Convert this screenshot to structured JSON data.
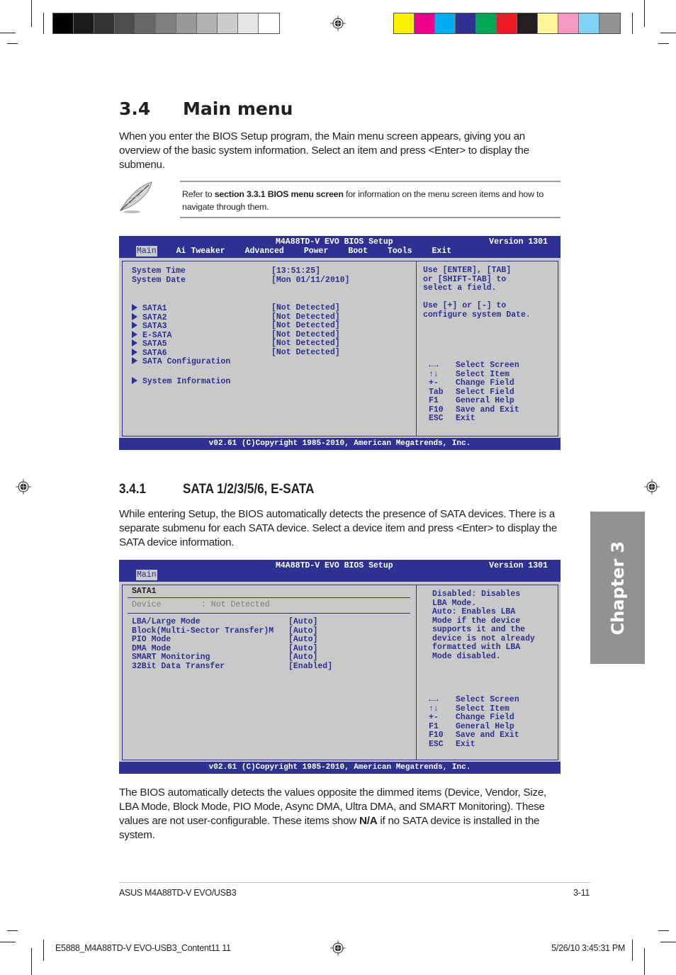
{
  "print_marks": {
    "gray_swatches": [
      "#000000",
      "#1c1c1c",
      "#333333",
      "#4d4d4d",
      "#666666",
      "#808080",
      "#999999",
      "#b3b3b3",
      "#cccccc",
      "#e6e6e6",
      "#ffffff"
    ],
    "color_swatches": [
      "#fff200",
      "#ec008c",
      "#00aeef",
      "#2e3192",
      "#00a651",
      "#ed1c24",
      "#231f20",
      "#fff799",
      "#f49ac2",
      "#7fd3f7",
      "#939192"
    ]
  },
  "section": {
    "number": "3.4",
    "title": "Main menu",
    "intro": "When you enter the BIOS Setup program, the Main menu screen appears, giving you an overview of the basic system information. Select an item and press <Enter> to display the submenu."
  },
  "note": {
    "icon": "feather-pen-icon",
    "prefix": "Refer to ",
    "bold": "section 3.3.1 BIOS menu screen",
    "suffix": " for information on the menu screen items and how to navigate through them."
  },
  "bios_main": {
    "title": "M4A88TD-V EVO BIOS Setup",
    "version": "Version 1301",
    "menu": [
      "Main",
      "Ai Tweaker",
      "Advanced",
      "Power",
      "Boot",
      "Tools",
      "Exit"
    ],
    "active_menu": "Main",
    "fields": [
      {
        "label": "System Time",
        "value": "[13:51:25]"
      },
      {
        "label": "System Date",
        "value": "[Mon 01/11/2010]"
      }
    ],
    "submenus": [
      {
        "label": "SATA1",
        "value": "[Not Detected]"
      },
      {
        "label": "SATA2",
        "value": "[Not Detected]"
      },
      {
        "label": "SATA3",
        "value": "[Not Detected]"
      },
      {
        "label": "E-SATA",
        "value": "[Not Detected]"
      },
      {
        "label": "SATA5",
        "value": "[Not Detected]"
      },
      {
        "label": "SATA6",
        "value": "[Not Detected]"
      },
      {
        "label": "SATA Configuration",
        "value": ""
      },
      {
        "label": "System Information",
        "value": ""
      }
    ],
    "help": [
      "Use [ENTER], [TAB]",
      "or [SHIFT-TAB] to",
      "select a field.",
      "",
      "Use [+] or [-] to",
      "configure system Date."
    ],
    "keys": [
      {
        "key": "←→",
        "action": "Select Screen"
      },
      {
        "key": "↑↓",
        "action": "Select Item"
      },
      {
        "key": "+-",
        "action": "Change Field"
      },
      {
        "key": "Tab",
        "action": "Select Field"
      },
      {
        "key": "F1",
        "action": "General Help"
      },
      {
        "key": "F10",
        "action": "Save and Exit"
      },
      {
        "key": "ESC",
        "action": "Exit"
      }
    ],
    "footer": "v02.61 (C)Copyright 1985-2010, American Megatrends, Inc."
  },
  "subsection": {
    "number": "3.4.1",
    "title": "SATA 1/2/3/5/6, E-SATA",
    "intro": "While entering Setup, the BIOS automatically detects the presence of SATA devices. There is a separate submenu for each SATA device. Select a device item and press <Enter> to display the SATA device information."
  },
  "bios_sata": {
    "title": "M4A88TD-V EVO BIOS Setup",
    "version": "Version 1301",
    "menu": [
      "Main"
    ],
    "panel_title": "SATA1",
    "device": {
      "label": "Device",
      "value": ": Not Detected"
    },
    "fields": [
      {
        "label": "LBA/Large Mode",
        "value": "[Auto]"
      },
      {
        "label": "Block(Multi-Sector Transfer)M",
        "value": "[Auto]"
      },
      {
        "label": "PIO Mode",
        "value": "[Auto]"
      },
      {
        "label": "DMA Mode",
        "value": "[Auto]"
      },
      {
        "label": "SMART Monitoring",
        "value": "[Auto]"
      },
      {
        "label": "32Bit Data Transfer",
        "value": "[Enabled]"
      }
    ],
    "help": [
      "Disabled: Disables",
      "LBA Mode.",
      "Auto: Enables LBA",
      "Mode if the device",
      "supports it and the",
      "device is not already",
      "formatted with LBA",
      "Mode disabled."
    ],
    "keys": [
      {
        "key": "←→",
        "action": "Select Screen"
      },
      {
        "key": "↑↓",
        "action": "Select Item"
      },
      {
        "key": "+-",
        "action": "Change Field"
      },
      {
        "key": "F1",
        "action": "General Help"
      },
      {
        "key": "F10",
        "action": "Save and Exit"
      },
      {
        "key": "ESC",
        "action": "Exit"
      }
    ],
    "footer": "v02.61 (C)Copyright 1985-2010, American Megatrends, Inc."
  },
  "closing": {
    "part1": "The BIOS automatically detects the values opposite the dimmed items (Device, Vendor, Size, LBA Mode, Block Mode, PIO Mode, Async DMA, Ultra DMA, and SMART Monitoring). These values are not user-configurable. These items show ",
    "bold": "N/A",
    "part2": " if no SATA device is installed in the system."
  },
  "chapter_tab": "Chapter 3",
  "page_footer": {
    "product": "ASUS M4A88TD-V EVO/USB3",
    "page": "3-11"
  },
  "slug": {
    "file": "E5888_M4A88TD-V EVO-USB3_Content11   11",
    "timestamp": "5/26/10   3:45:31 PM"
  }
}
